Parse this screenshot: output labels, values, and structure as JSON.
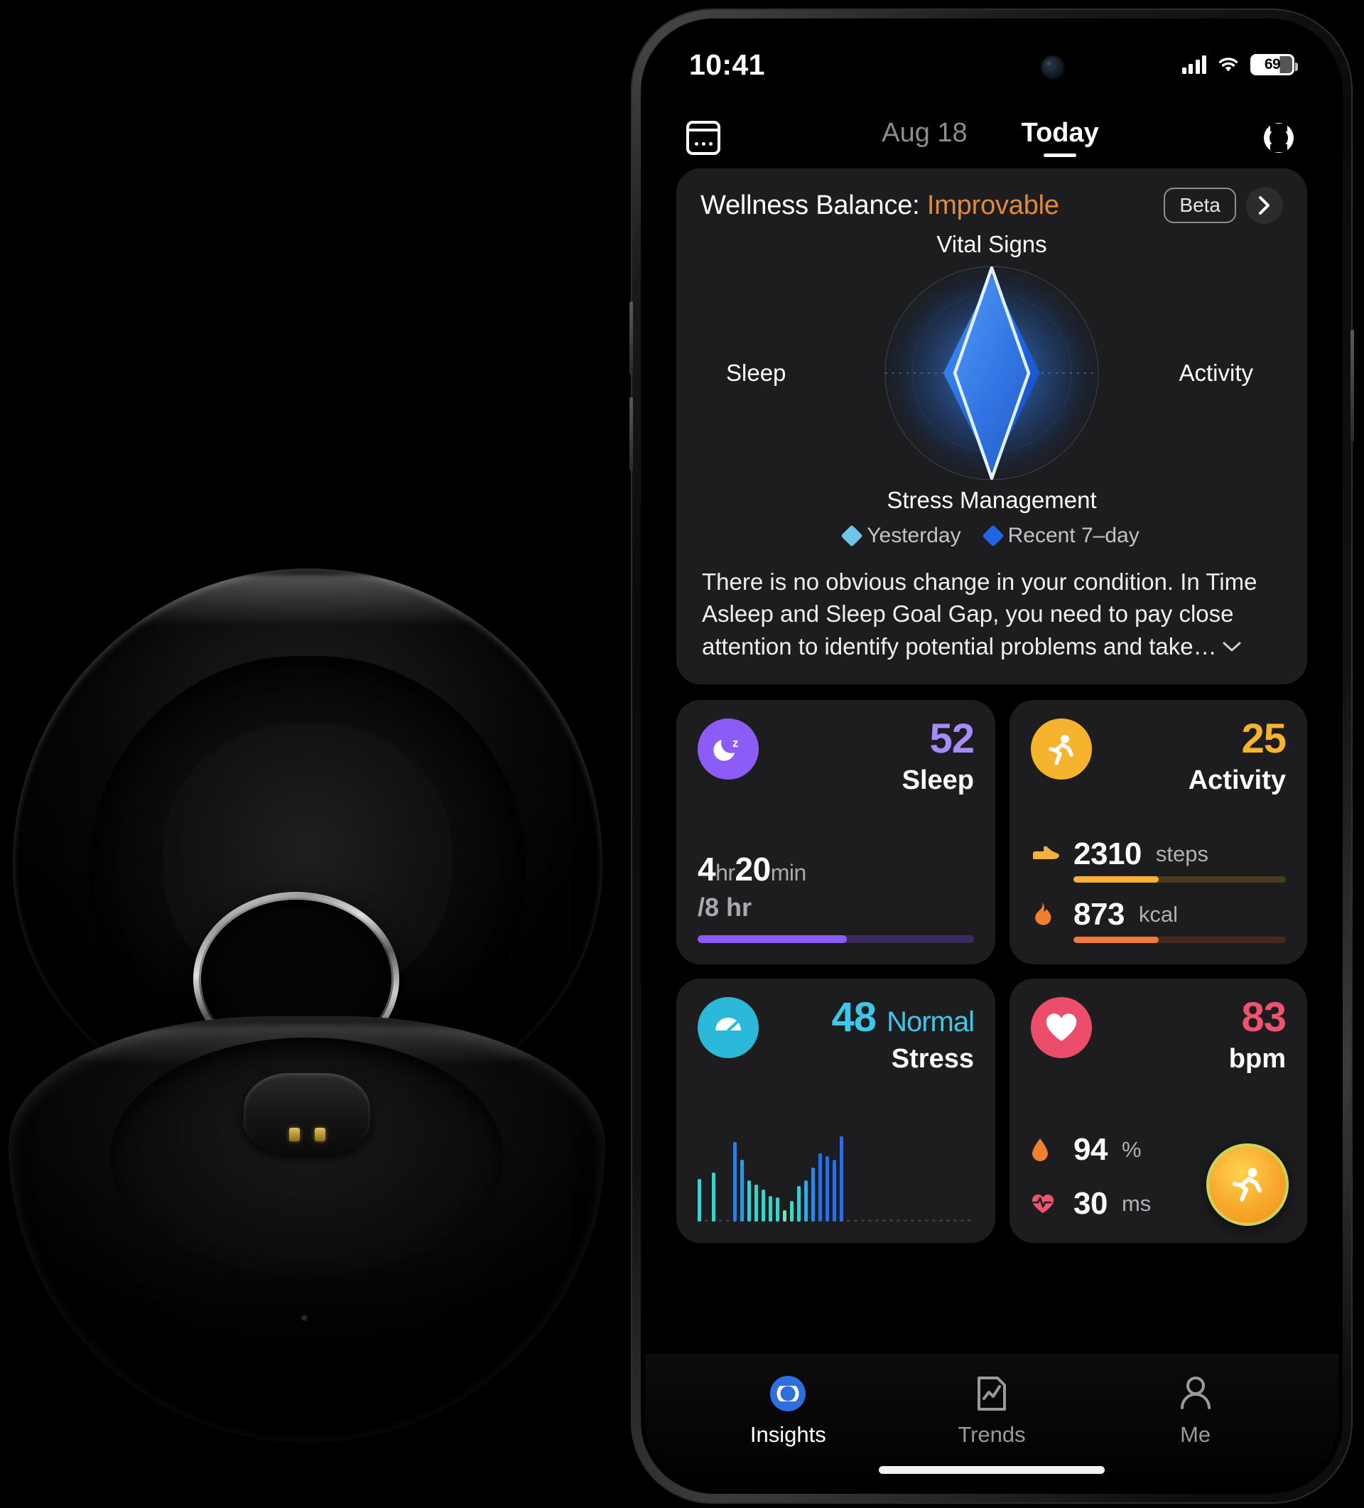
{
  "product": {
    "name": "smart-ring-charging-case",
    "description": "Black smart ring charging case, open, with silver smart ring resting in lid"
  },
  "phone": {
    "status_bar": {
      "time": "10:41",
      "signal_icon": "cellular-bars-icon",
      "wifi_icon": "wifi-icon",
      "battery_level": "69",
      "battery_percent": 69
    },
    "nav": {
      "calendar_icon": "calendar-icon",
      "sync_icon": "ring-sync-icon",
      "dates": [
        {
          "label": "Aug 18",
          "active": false
        },
        {
          "label": "Today",
          "active": true
        }
      ]
    },
    "wellness": {
      "title_prefix": "Wellness Balance: ",
      "status": "Improvable",
      "status_color": "#e08a3c",
      "beta_label": "Beta",
      "chevron_icon": "chevron-right-icon",
      "description": "There is no obvious change in your condition. In Time Asleep and Sleep Goal Gap, you need to pay close attention to identify potential problems and take…",
      "expand_icon": "chevron-down-icon",
      "legend": [
        {
          "label": "Yesterday",
          "color": "#6fc6e8"
        },
        {
          "label": "Recent 7–day",
          "color": "#1f66e5"
        }
      ]
    },
    "chart_data": {
      "type": "radar",
      "title": "Wellness Balance",
      "axes": [
        "Vital Signs",
        "Activity",
        "Stress Management",
        "Sleep"
      ],
      "axis_label_positions": [
        "top",
        "right",
        "bottom",
        "left"
      ],
      "range": [
        0,
        100
      ],
      "grid": true,
      "legend_position": "bottom",
      "series": [
        {
          "name": "Yesterday",
          "color": "#6fc6e8",
          "values": [
            92,
            34,
            90,
            32
          ]
        },
        {
          "name": "Recent 7–day",
          "color": "#1f66e5",
          "values": [
            86,
            44,
            84,
            42
          ]
        }
      ]
    },
    "metrics": {
      "sleep": {
        "icon": "moon-sleep-icon",
        "icon_bg": "#8b5cf6",
        "score": "52",
        "score_color": "#a78bfa",
        "name": "Sleep",
        "duration_hours": "4",
        "hours_unit": "hr",
        "duration_minutes": "20",
        "minutes_unit": "min",
        "goal": "/8 hr",
        "progress_percent": 54,
        "bar_color": "#8b5cf6",
        "bar_track": "#3a2b5e"
      },
      "activity": {
        "icon": "running-person-icon",
        "icon_bg": "#f5b32e",
        "score": "25",
        "score_color": "#f5b32e",
        "name": "Activity",
        "rows": [
          {
            "glyph": "shoe-icon",
            "glyph_color": "#f0b23c",
            "value": "2310",
            "unit": "steps",
            "percent": 40,
            "bar_color": "#f5b32e",
            "bar_track": "#4a3d1c"
          },
          {
            "glyph": "flame-icon",
            "glyph_color": "#f08030",
            "value": "873",
            "unit": "kcal",
            "percent": 40,
            "bar_color": "#f07a3c",
            "bar_track": "#452a1c"
          }
        ]
      },
      "stress": {
        "icon": "stress-gauge-icon",
        "icon_bg": "#2cb8d8",
        "score": "48",
        "status": "Normal",
        "score_color": "#3cc8e8",
        "name": "Stress",
        "chart": {
          "type": "bar",
          "values": [
            46,
            0,
            52,
            0,
            0,
            86,
            66,
            44,
            40,
            34,
            28,
            26,
            12,
            22,
            38,
            44,
            58,
            74,
            70,
            66,
            92
          ],
          "value_colors": [
            "#3fd0c9",
            "#3a3a3c",
            "#3fd0c9",
            "#3a3a3c",
            "#3a3a3c",
            "#2e7de0",
            "#2e9ad8",
            "#3fc9cf",
            "#3fd0c9",
            "#3fd0c9",
            "#3fd0c9",
            "#3fd0c9",
            "#7ee0a8",
            "#4ad4bb",
            "#3fc9d4",
            "#35a8dd",
            "#2e86de",
            "#2e6fe0",
            "#2e6fe0",
            "#2e6fe0",
            "#2e6fe0"
          ],
          "trailing_placeholder_count": 18,
          "placeholder_color": "#3a3a3c"
        }
      },
      "heart": {
        "icon": "heart-icon",
        "icon_bg": "#ec4d6b",
        "score": "83",
        "score_color": "#f0536f",
        "name": "bpm",
        "rows": [
          {
            "glyph": "blood-drop-icon",
            "glyph_color": "#f08030",
            "value": "94",
            "unit": "%"
          },
          {
            "glyph": "heart-pulse-icon",
            "glyph_color": "#f0536f",
            "value": "30",
            "unit": "ms"
          }
        ],
        "fab": {
          "icon": "workout-running-icon",
          "name": "start-workout-button"
        }
      }
    },
    "tabs": [
      {
        "label": "Insights",
        "icon": "insights-ring-icon",
        "active": true
      },
      {
        "label": "Trends",
        "icon": "trends-chart-icon",
        "active": false
      },
      {
        "label": "Me",
        "icon": "person-icon",
        "active": false
      }
    ]
  }
}
